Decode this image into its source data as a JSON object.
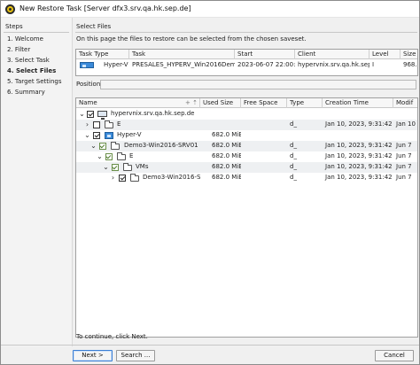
{
  "window": {
    "title": "New Restore Task [Server dfx3.srv.qa.hk.sep.de]"
  },
  "steps": {
    "title": "Steps",
    "items": [
      {
        "label": "1. Welcome",
        "active": false
      },
      {
        "label": "2. Filter",
        "active": false
      },
      {
        "label": "3. Select Task",
        "active": false
      },
      {
        "label": "4. Select Files",
        "active": true
      },
      {
        "label": "5. Target Settings",
        "active": false
      },
      {
        "label": "6. Summary",
        "active": false
      }
    ]
  },
  "main": {
    "title": "Select Files",
    "description": "On this page the files to restore can be selected from the chosen saveset."
  },
  "task_table": {
    "columns": [
      "Task Type",
      "Task",
      "Start",
      "Client",
      "Level",
      "Size"
    ],
    "rows": [
      {
        "task_type_label": "Hyper-V",
        "task": "PRESALES_HYPERV_Win2016Demo3...",
        "start": "2023-06-07 22:00:02",
        "client": "hypervnix.srv.qa.hk.sep.de",
        "level": "I",
        "size": "968.4"
      }
    ]
  },
  "position": {
    "label": "Position:",
    "value": ""
  },
  "file_tree": {
    "columns": [
      "Name",
      "Used Size",
      "Free Space",
      "Type",
      "Creation Time",
      "Modif"
    ],
    "rows": [
      {
        "name": "hypervnix.srv.qa.hk.sep.de",
        "level": 0,
        "expanded": true,
        "check": "checked",
        "icon": "monitor-icon",
        "used_size": "",
        "free_space": "",
        "type": "",
        "creation_time": "",
        "modified": ""
      },
      {
        "name": "E",
        "level": 1,
        "expanded": false,
        "check": "unchecked",
        "icon": "folder-icon",
        "used_size": "",
        "free_space": "",
        "type": "d_",
        "creation_time": "Jan 10, 2023, 9:31:42 AM",
        "modified": "Jan 10"
      },
      {
        "name": "Hyper-V",
        "level": 1,
        "expanded": true,
        "check": "checked",
        "icon": "hyperv-icon",
        "used_size": "682.0 MiB",
        "free_space": "",
        "type": "",
        "creation_time": "",
        "modified": ""
      },
      {
        "name": "Demo3-Win2016-SRV01",
        "level": 2,
        "expanded": true,
        "check": "partial",
        "icon": "vm-icon",
        "used_size": "682.0 MiB",
        "free_space": "",
        "type": "d_",
        "creation_time": "Jan 10, 2023, 9:31:42 AM",
        "modified": "Jun 7"
      },
      {
        "name": "E",
        "level": 3,
        "expanded": true,
        "check": "partial",
        "icon": "folder-icon",
        "used_size": "682.0 MiB",
        "free_space": "",
        "type": "d_",
        "creation_time": "Jan 10, 2023, 9:31:42 AM",
        "modified": "Jun 7"
      },
      {
        "name": "VMs",
        "level": 4,
        "expanded": true,
        "check": "partial",
        "icon": "folder-icon",
        "used_size": "682.0 MiB",
        "free_space": "",
        "type": "d_",
        "creation_time": "Jan 10, 2023, 9:31:42 AM",
        "modified": "Jun 7"
      },
      {
        "name": "Demo3-Win2016-SR...",
        "level": 5,
        "expanded": false,
        "check": "checked",
        "icon": "folder-icon",
        "used_size": "682.0 MiB",
        "free_space": "",
        "type": "d_",
        "creation_time": "Jan 10, 2023, 9:31:42 AM",
        "modified": "Jun 7"
      }
    ]
  },
  "footer": {
    "hint": "To continue, click Next.",
    "next_label": "Next >",
    "search_label": "Search ...",
    "cancel_label": "Cancel"
  }
}
